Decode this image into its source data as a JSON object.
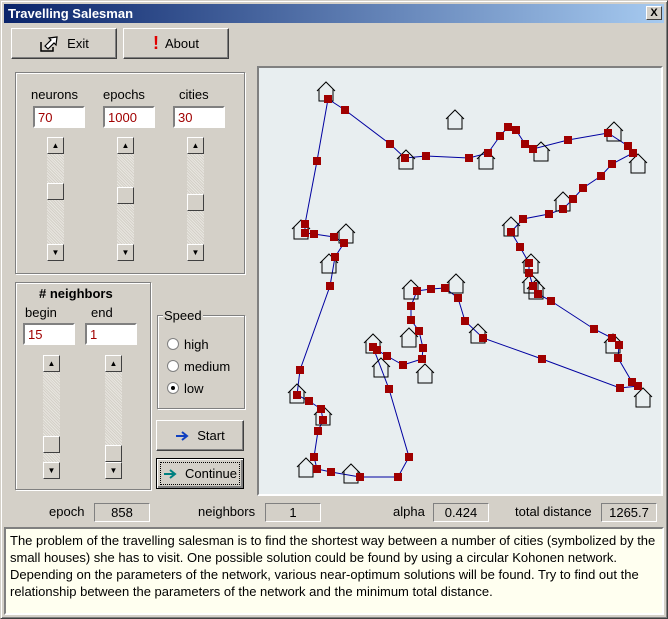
{
  "window": {
    "title": "Travelling Salesman",
    "close_label": "X"
  },
  "toolbar": {
    "exit_label": "Exit",
    "about_label": "About",
    "about_glyph": "!",
    "about_color": "#e00000"
  },
  "params": {
    "neurons": {
      "label": "neurons",
      "value": "70",
      "level": 0.4
    },
    "epochs": {
      "label": "epochs",
      "value": "1000",
      "level": 0.45
    },
    "cities": {
      "label": "cities",
      "value": "30",
      "level": 0.55
    }
  },
  "neighbors": {
    "title": "# neighbors",
    "begin": {
      "label": "begin",
      "value": "15",
      "level": 0.88
    },
    "end": {
      "label": "end",
      "value": "1",
      "level": 1.0
    }
  },
  "speed": {
    "title": "Speed",
    "options": [
      "high",
      "medium",
      "low"
    ],
    "selected": "low"
  },
  "actions": {
    "start_label": "Start",
    "continue_label": "Continue"
  },
  "status": {
    "epoch_label": "epoch",
    "epoch_value": "858",
    "neighbors_label": "neighbors",
    "neighbors_value": "1",
    "alpha_label": "alpha",
    "alpha_value": "0.424",
    "distance_label": "total distance",
    "distance_value": "1265.7"
  },
  "description": "The problem of the travelling salesman is to find the shortest way between a number of cities (symbolized by the small houses) she has to visit. One possible solution could be found by using a circular Kohonen network. Depending on the parameters of the network, various near-optimum solutions will be found. Try to find out the relationship between the parameters of the network and the minimum total distance.",
  "colors": {
    "route": "#0000a0",
    "neuron": "#a00000",
    "canvas": "#e8eef0"
  }
}
